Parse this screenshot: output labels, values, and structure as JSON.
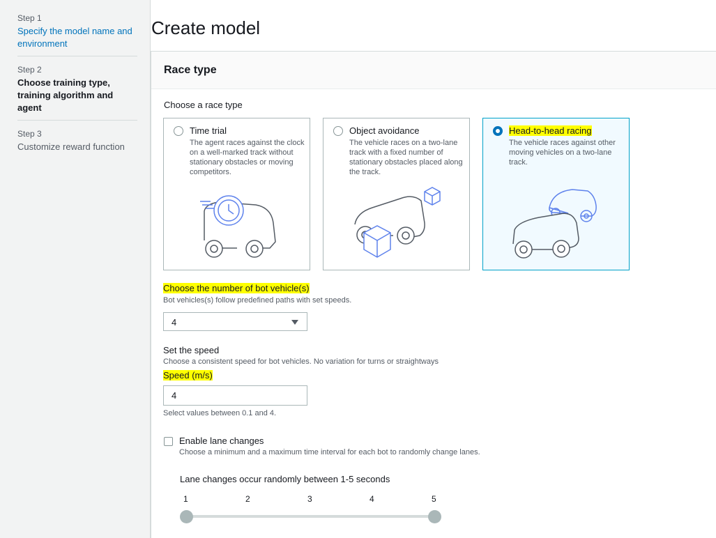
{
  "sidebar": {
    "steps": [
      {
        "number": "Step 1",
        "title": "Specify the model name and environment"
      },
      {
        "number": "Step 2",
        "title": "Choose training type, training algorithm and agent"
      },
      {
        "number": "Step 3",
        "title": "Customize reward function"
      }
    ]
  },
  "page_title": "Create model",
  "race_panel": {
    "header": "Race type",
    "choose_label": "Choose a race type",
    "options": [
      {
        "title": "Time trial",
        "description": "The agent races against the clock on a well-marked track without stationary obstacles or moving competitors.",
        "selected": false,
        "icon": "time-trial-car-illustration"
      },
      {
        "title": "Object avoidance",
        "description": "The vehicle races on a two-lane track with a fixed number of stationary obstacles placed along the track.",
        "selected": false,
        "icon": "object-avoidance-car-illustration"
      },
      {
        "title": "Head-to-head racing",
        "description": "The vehicle races against other moving vehicles on a two-lane track.",
        "selected": true,
        "icon": "head-to-head-cars-illustration"
      }
    ]
  },
  "bots": {
    "label": "Choose the number of bot vehicle(s)",
    "description": "Bot vehicles(s) follow predefined paths with set speeds.",
    "selected_value": "4"
  },
  "speed": {
    "section_label": "Set the speed",
    "section_description": "Choose a consistent speed for bot vehicles. No variation for turns or straightways",
    "field_label": "Speed (m/s)",
    "value": "4",
    "hint": "Select values between 0.1 and 4."
  },
  "lane_changes": {
    "checkbox_label": "Enable lane changes",
    "checked": false,
    "description": "Choose a minimum and a maximum time interval for each bot to randomly change lanes.",
    "range_label": "Lane changes occur randomly between 1-5 seconds",
    "ticks": [
      "1",
      "2",
      "3",
      "4",
      "5"
    ],
    "range_min": 1,
    "range_max": 5
  },
  "colors": {
    "link": "#0073bb",
    "highlight": "#ffff00",
    "selected_card_bg": "#f1faff",
    "selected_card_border": "#00a1c9",
    "illustration_gray": "#545b64",
    "illustration_blue": "#5e82ec"
  }
}
